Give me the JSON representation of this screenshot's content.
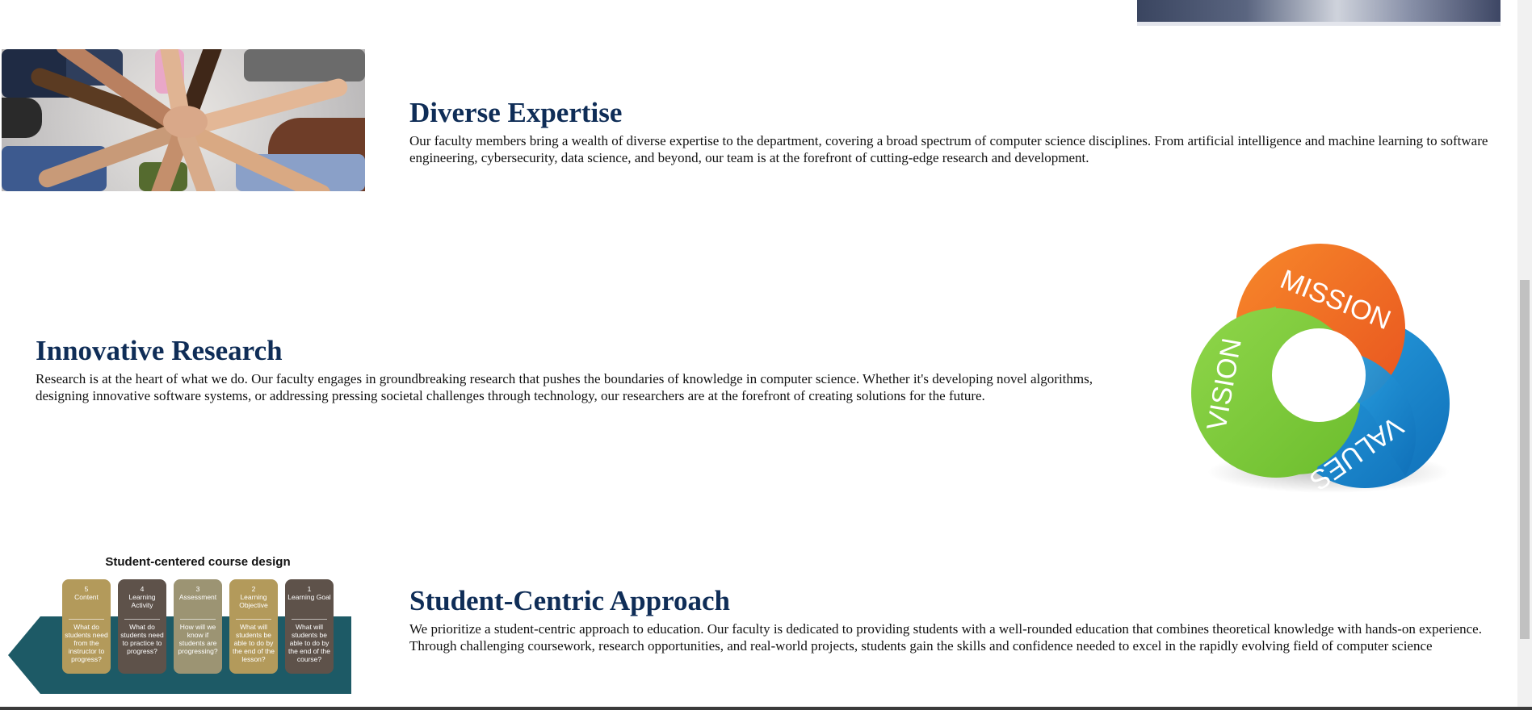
{
  "sections": {
    "diverse": {
      "title": "Diverse Expertise",
      "body": "Our faculty members bring a wealth of diverse expertise to the department, covering a broad spectrum of computer science disciplines. From artificial intelligence and machine learning to software engineering, cybersecurity, data science, and beyond, our team is at the forefront of cutting-edge research and development."
    },
    "research": {
      "title": "Innovative Research",
      "body": "Research is at the heart of what we do. Our faculty engages in groundbreaking research that pushes the boundaries of knowledge in computer science. Whether it's developing novel algorithms, designing innovative software systems, or addressing pressing societal challenges through technology, our researchers are at the forefront of creating solutions for the future."
    },
    "student": {
      "title": "Student-Centric Approach",
      "body": "We prioritize a student-centric approach to education. Our faculty is dedicated to providing students with a well-rounded education that combines theoretical knowledge with hands-on experience. Through challenging coursework, research opportunities, and real-world projects, students gain the skills and confidence needed to excel in the rapidly evolving field of computer science"
    }
  },
  "mvv_graphic": {
    "mission": "MISSION",
    "vision": "VISION",
    "values": "VALUES",
    "colors": {
      "mission": "#f06a22",
      "vision": "#7fcc3a",
      "values": "#1b8fd6"
    }
  },
  "course_graphic": {
    "title": "Student-centered course design",
    "steps": [
      {
        "num": "5",
        "head": "Content",
        "q": "What do students need from the instructor to progress?",
        "color": "#b39a5b"
      },
      {
        "num": "4",
        "head": "Learning Activity",
        "q": "What do students need to practice to progress?",
        "color": "#5e524a"
      },
      {
        "num": "3",
        "head": "Assessment",
        "q": "How will we know if students are progressing?",
        "color": "#9c9473"
      },
      {
        "num": "2",
        "head": "Learning Objective",
        "q": "What will students be able to do by the end of the lesson?",
        "color": "#b39a5b"
      },
      {
        "num": "1",
        "head": "Learning Goal",
        "q": "What will students be able to do by the end of the course?",
        "color": "#5e524a"
      }
    ],
    "band_color": "#1d5a66"
  },
  "images": {
    "top_photo": "lab-photo",
    "hands_photo": "team-hands-photo"
  }
}
